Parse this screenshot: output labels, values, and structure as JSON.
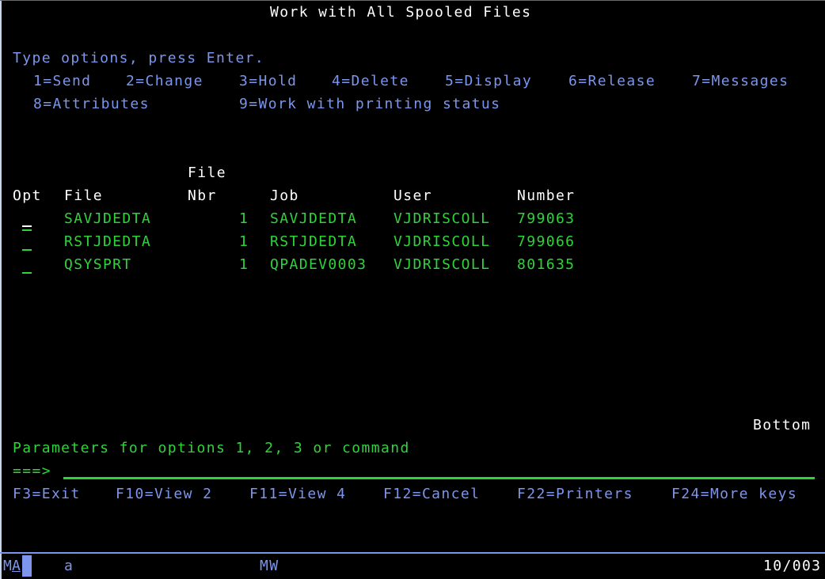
{
  "screen": {
    "title": "Work with All Spooled Files",
    "instructions": "Type options, press Enter.",
    "options_row1": [
      {
        "label": "1=Send"
      },
      {
        "label": "2=Change"
      },
      {
        "label": "3=Hold"
      },
      {
        "label": "4=Delete"
      },
      {
        "label": "5=Display"
      },
      {
        "label": "6=Release"
      },
      {
        "label": "7=Messages"
      }
    ],
    "options_row2": [
      {
        "label": "8=Attributes"
      },
      {
        "label": "9=Work with printing status"
      }
    ]
  },
  "table": {
    "headers": {
      "opt": "Opt",
      "file": "File",
      "file_nbr_top": "File",
      "file_nbr_bottom": "Nbr",
      "job": "Job",
      "user": "User",
      "number": "Number"
    },
    "rows": [
      {
        "opt": "",
        "opt_marker": "=",
        "file": "SAVJDEDTA",
        "nbr": "1",
        "job": "SAVJDEDTA",
        "user": "VJDRISCOLL",
        "number": "799063"
      },
      {
        "opt": "",
        "opt_marker": "_",
        "file": "RSTJDEDTA",
        "nbr": "1",
        "job": "RSTJDEDTA",
        "user": "VJDRISCOLL",
        "number": "799066"
      },
      {
        "opt": "",
        "opt_marker": "_",
        "file": "QSYSPRT",
        "nbr": "1",
        "job": "QPADEV0003",
        "user": "VJDRISCOLL",
        "number": "801635"
      }
    ],
    "scroll_indicator": "Bottom"
  },
  "command": {
    "label": "Parameters for options 1, 2, 3 or command",
    "prompt": "===>",
    "value": ""
  },
  "function_keys": [
    {
      "label": "F3=Exit"
    },
    {
      "label": "F10=View 2"
    },
    {
      "label": "F11=View 4"
    },
    {
      "label": "F12=Cancel"
    },
    {
      "label": "F22=Printers"
    },
    {
      "label": "F24=More keys"
    }
  ],
  "status_bar": {
    "mode_m": "M",
    "mode_a": "A",
    "session": "a",
    "mw": "MW",
    "cursor_position": "10/003"
  },
  "colors": {
    "background": "#000000",
    "title_text": "#ffffff",
    "instruction_text": "#7b96ec",
    "data_text": "#2fd43a",
    "status_bar_line": "#7b96ec"
  }
}
